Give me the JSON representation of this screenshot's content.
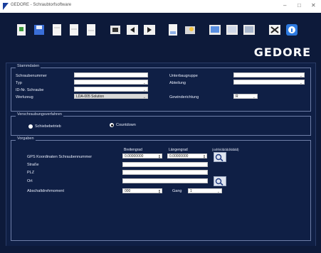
{
  "window": {
    "title": "GEDORE - Schraubtorfsoftware",
    "controls": {
      "minimize": "–",
      "maximize": "□",
      "close": "✕"
    }
  },
  "toolbar": {
    "icons": [
      "new-document-icon",
      "save-icon",
      "document-icon",
      "document-icon",
      "document-icon",
      "tool-icon",
      "arrow-left-icon",
      "arrow-right-icon",
      "report-icon",
      "folder-icon",
      "screen-icon",
      "screen-icon",
      "screen-icon",
      "exit-icon",
      "info-icon"
    ]
  },
  "brand": {
    "name": "GEDORE"
  },
  "stammdaten": {
    "title": "Stammdaten",
    "left": [
      {
        "label": "Schraubenummer",
        "value": ""
      },
      {
        "label": "Typ",
        "value": ""
      },
      {
        "label": "ID-Nr. Schraube",
        "value": ""
      },
      {
        "label": "Werkzeug",
        "value": "LDA-005 Solution"
      }
    ],
    "right": [
      {
        "label": "Unterbaugruppe",
        "value": ""
      },
      {
        "label": "Abteilung",
        "value": ""
      },
      {
        "label": "Gewinderichtung",
        "value": "R"
      }
    ]
  },
  "verschraubung": {
    "title": "Verschraubungsverfahren",
    "options": [
      {
        "label": "Schiebebetrieb",
        "selected": false
      },
      {
        "label": "Countdown",
        "selected": true
      }
    ]
  },
  "vorgaben": {
    "title": "Vorgaben",
    "headers": {
      "breitengrad": "Breitengrad",
      "laengengrad": "Längengrad",
      "format": "(xxhh/ddddd/dddd)"
    },
    "rows": {
      "gps": {
        "label": "GPS Koordinaten Schraubennummer",
        "lat": "0.00000000",
        "lon": "0.00000000"
      },
      "strasse": {
        "label": "Straße",
        "value": ""
      },
      "plz": {
        "label": "PLZ",
        "value": ""
      },
      "ort": {
        "label": "Ort",
        "value": ""
      },
      "abschalt": {
        "label": "Abschaltdrehmoment",
        "value": "000",
        "gang_label": "Gang",
        "gang_value": "1"
      }
    }
  }
}
